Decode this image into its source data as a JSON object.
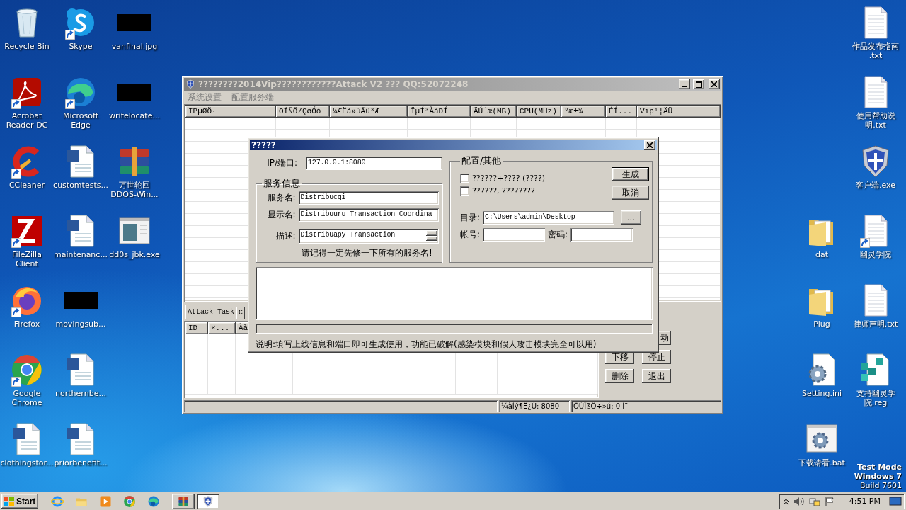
{
  "desktop": {
    "left_columns": [
      [
        {
          "label": "Recycle Bin",
          "kind": "recycle",
          "shortcut": false
        },
        {
          "label": "Acrobat Reader DC",
          "kind": "acrobat",
          "shortcut": true
        },
        {
          "label": "CCleaner",
          "kind": "ccleaner",
          "shortcut": true
        },
        {
          "label": "FileZilla Client",
          "kind": "filezilla",
          "shortcut": true
        },
        {
          "label": "Firefox",
          "kind": "firefox",
          "shortcut": true
        },
        {
          "label": "Google Chrome",
          "kind": "chrome",
          "shortcut": true
        },
        {
          "label": "clothingstor...",
          "kind": "word",
          "shortcut": false
        }
      ],
      [
        {
          "label": "Skype",
          "kind": "skype",
          "shortcut": true
        },
        {
          "label": "Microsoft Edge",
          "kind": "edge",
          "shortcut": true
        },
        {
          "label": "customtests...",
          "kind": "word",
          "shortcut": false
        },
        {
          "label": "maintenanc...",
          "kind": "word",
          "shortcut": false
        },
        {
          "label": "movingsub...",
          "kind": "redacted",
          "shortcut": false
        },
        {
          "label": "northernbe...",
          "kind": "word",
          "shortcut": false
        },
        {
          "label": "priorbenefit...",
          "kind": "word",
          "shortcut": false
        }
      ],
      [
        {
          "label": "vanfinal.jpg",
          "kind": "redacted",
          "shortcut": false
        },
        {
          "label": "writelocate...",
          "kind": "redacted",
          "shortcut": false
        },
        {
          "label": "万世轮回 DDOS-Win...",
          "kind": "winrar",
          "shortcut": false
        },
        {
          "label": "dd0s_jbk.exe",
          "kind": "window",
          "shortcut": false
        }
      ]
    ],
    "right_columns": [
      [
        {
          "label": "dat",
          "kind": "folder",
          "shortcut": false
        },
        {
          "label": "Plug",
          "kind": "folder",
          "shortcut": false
        },
        {
          "label": "Setting.ini",
          "kind": "settings",
          "shortcut": false
        },
        {
          "label": "下载请看.bat",
          "kind": "batch",
          "shortcut": false
        }
      ],
      [
        {
          "label": "作品发布指南 .txt",
          "kind": "text",
          "shortcut": false
        },
        {
          "label": "使用帮助说明.txt",
          "kind": "text",
          "shortcut": false
        },
        {
          "label": "客户端.exe",
          "kind": "shield",
          "shortcut": false
        },
        {
          "label": "幽灵学院",
          "kind": "text",
          "shortcut": true
        },
        {
          "label": "律师声明.txt",
          "kind": "text",
          "shortcut": false
        },
        {
          "label": "支持幽灵学院.reg",
          "kind": "registry",
          "shortcut": false
        }
      ]
    ],
    "edition": [
      "Test Mode",
      "Windows 7",
      "Build 7601"
    ]
  },
  "main_window": {
    "title": "????????2014Vip????????????Attack V2 ??? QQ:52072248",
    "active": false,
    "menu": [
      "系统设置",
      "配置服务端"
    ],
    "hosts_table": {
      "columns": [
        "IPµØÖ·",
        "OÏÑÖ/ÇøÓò",
        "¼ÆËã»úÃû³Æ",
        "ÏµÍ³ÀàÐÍ",
        "ÄÚ´æ(MB)",
        "CPU(MHz)",
        "°æ±¾",
        "ÉÍ...",
        "Vip¹¦ÄÜ"
      ]
    },
    "bottom_tabs": [
      {
        "label": "Attack Task",
        "selected": true
      },
      {
        "label": "C",
        "selected": false
      }
    ],
    "task_table": {
      "columns": [
        "ID",
        "×...",
        "Àà"
      ]
    },
    "buttons": [
      "动",
      "下移",
      "停止",
      "删除",
      "退出"
    ],
    "status_bar": [
      "¼àÌý¶Ë¿Ú: 8080",
      "ÔÚÏßÖ÷»ú: 0 Ì¨"
    ]
  },
  "dialog": {
    "title": "?????",
    "active": true,
    "ip": {
      "label": "IP/端口:",
      "value": "127.0.0.1:8080"
    },
    "service_group": {
      "title": "服务信息",
      "fields": [
        {
          "label": "服务名:",
          "value": "Distribucqi",
          "kind": "text"
        },
        {
          "label": "显示名:",
          "value": "Distribuuru Transaction Coordina",
          "kind": "text"
        },
        {
          "label": "描述:",
          "value": "Distribuapy Transaction",
          "kind": "spinner"
        }
      ],
      "note": "请记得一定先修一下所有的服务名!"
    },
    "other_group": {
      "title": "配置/其他",
      "options": [
        {
          "label": "??????+???? (????)",
          "checked": false
        },
        {
          "label": "??????, ????????",
          "checked": false
        }
      ],
      "buttons": [
        {
          "label": "生成",
          "default": true
        },
        {
          "label": "取消",
          "default": false
        }
      ],
      "directory": {
        "label": "目录:",
        "value": "C:\\Users\\admin\\Desktop",
        "browse": "..."
      },
      "account": {
        "label": "帐号:"
      },
      "password": {
        "label": "密码:"
      }
    },
    "progress": {
      "level": 0
    },
    "footer": "说明:填写上线信息和端口即可生成使用，功能已破解(感染模块和假人攻击模块完全可以用)"
  },
  "taskbar": {
    "start": "Start",
    "quick_launch": [
      {
        "kind": "ie"
      },
      {
        "kind": "explorer"
      },
      {
        "kind": "media"
      },
      {
        "kind": "chrome"
      },
      {
        "kind": "edge"
      }
    ],
    "tasks": [
      {
        "kind": "winrar",
        "selected": false
      },
      {
        "kind": "shield",
        "selected": true
      }
    ],
    "clock": "4:51 PM"
  }
}
